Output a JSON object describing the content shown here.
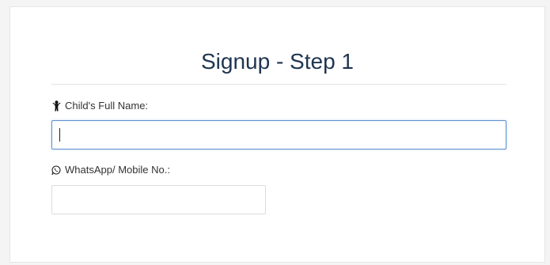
{
  "form": {
    "title": "Signup - Step 1",
    "child_name": {
      "label": "Child's Full Name:",
      "icon": "child-icon",
      "value": "",
      "placeholder": ""
    },
    "phone": {
      "label": "WhatsApp/ Mobile No.:",
      "icon": "whatsapp-icon",
      "value": "",
      "placeholder": ""
    }
  },
  "colors": {
    "title": "#1f3550",
    "focus_border": "#5b8fd0"
  }
}
